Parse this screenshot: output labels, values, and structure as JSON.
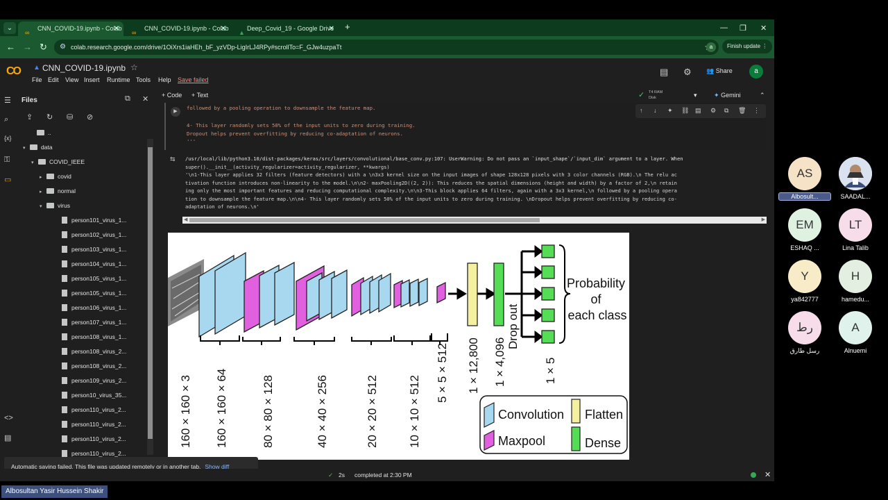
{
  "browser": {
    "tabs": [
      {
        "title": "CNN_COVID-19.ipynb - Colab",
        "active": true
      },
      {
        "title": "CNN_COVID-19.ipynb - Colab",
        "active": false
      },
      {
        "title": "Deep_Covid_19 - Google Drive",
        "active": false
      }
    ],
    "new_tab": "+",
    "url": "colab.research.google.com/drive/1OiXrs1iaHEh_bF_yzVDp-LigIrLJ4RPy#scrollTo=F_GJw4uzpaTt",
    "profile_initial": "a",
    "finish_update": "Finish update"
  },
  "colab": {
    "notebook_title": "CNN_COVID-19.ipynb",
    "menu": [
      "File",
      "Edit",
      "View",
      "Insert",
      "Runtime",
      "Tools",
      "Help"
    ],
    "save_status": "Save failed",
    "share": "Share",
    "user_initial": "a",
    "add_code": "+ Code",
    "add_text": "+ Text",
    "runtime_label": "T4",
    "ram_label": "RAM",
    "disk_label": "Disk",
    "gemini": "Gemini"
  },
  "files_panel": {
    "title": "Files",
    "tree": [
      {
        "label": "..",
        "kind": "folder",
        "arrow": ""
      },
      {
        "label": "data",
        "kind": "folder",
        "arrow": "▾"
      },
      {
        "label": "COVID_IEEE",
        "kind": "folder",
        "arrow": "▾"
      },
      {
        "label": "covid",
        "kind": "folder",
        "arrow": "▸"
      },
      {
        "label": "normal",
        "kind": "folder",
        "arrow": "▸"
      },
      {
        "label": "virus",
        "kind": "folder",
        "arrow": "▾"
      },
      {
        "label": "person101_virus_1...",
        "kind": "file"
      },
      {
        "label": "person102_virus_1...",
        "kind": "file"
      },
      {
        "label": "person103_virus_1...",
        "kind": "file"
      },
      {
        "label": "person104_virus_1...",
        "kind": "file"
      },
      {
        "label": "person105_virus_1...",
        "kind": "file"
      },
      {
        "label": "person105_virus_1...",
        "kind": "file"
      },
      {
        "label": "person106_virus_1...",
        "kind": "file"
      },
      {
        "label": "person107_virus_1...",
        "kind": "file"
      },
      {
        "label": "person108_virus_1...",
        "kind": "file"
      },
      {
        "label": "person108_virus_2...",
        "kind": "file"
      },
      {
        "label": "person108_virus_2...",
        "kind": "file"
      },
      {
        "label": "person109_virus_2...",
        "kind": "file"
      },
      {
        "label": "person10_virus_35...",
        "kind": "file"
      },
      {
        "label": "person110_virus_2...",
        "kind": "file"
      },
      {
        "label": "person110_virus_2...",
        "kind": "file"
      },
      {
        "label": "person110_virus_2...",
        "kind": "file"
      },
      {
        "label": "person110_virus_2...",
        "kind": "file"
      }
    ]
  },
  "toast": {
    "message": "Automatic saving failed. This file was updated remotely or in another tab.",
    "action": "Show diff"
  },
  "cell": {
    "lines": [
      "followed by a pooling operation to downsample the feature map.",
      "",
      "4- This layer randomly sets 50% of the input units to zero during training.",
      "Dropout helps prevent overfitting by reducing co-adaptation of neurons.",
      "'''"
    ]
  },
  "output": {
    "lines": [
      "/usr/local/lib/python3.10/dist-packages/keras/src/layers/convolutional/base_conv.py:107: UserWarning: Do not pass an `input_shape`/`input_dim` argument to a layer. When",
      "  super().__init__(activity_regularizer=activity_regularizer, **kwargs)",
      "'\\n1-This layer applies 32 filters (feature detectors) with a \\n3x3 kernel size on the input images of shape 128x128 pixels with 3 color channels (RGB).\\n The relu ac",
      "tivation function introduces non-linearity to the model.\\n\\n2- maxPooling2D((2, 2)): This reduces the spatial dimensions (height and width) by a factor of 2,\\n retain",
      "ing only the most important features and reducing computational complexity.\\n\\n3-This block applies 64 filters, again with a 3x3 kernel,\\n followed by a pooling opera",
      "tion to downsample the feature map.\\n\\n4- This layer randomly sets 50% of the input units to zero during training. \\nDropout helps prevent overfitting by reducing co-",
      "adaptation of neurons.\\n'"
    ]
  },
  "figure": {
    "dims": [
      "160 × 160 × 3",
      "160 × 160 × 64",
      "80 × 80 × 128",
      "40 × 40 × 256",
      "20 × 20 × 512",
      "10 × 10 × 512",
      "5 × 5 × 512",
      "1 × 12,800",
      "1 × 4,096",
      "1 × 5"
    ],
    "dropout": "Drop out",
    "output_text": [
      "Probability",
      "of",
      "each class"
    ],
    "legend": [
      "Convolution",
      "Flatten",
      "Maxpool",
      "Dense"
    ],
    "colors": {
      "convolution": "#a8d8f0",
      "maxpool": "#e060e0",
      "flatten": "#f5f0a0",
      "dense": "#55dd55"
    }
  },
  "status": {
    "elapsed": "2s",
    "completed": "completed at 2:30 PM"
  },
  "participants": [
    {
      "initials": "AS",
      "name": "Albosult...",
      "bg": "#f6e3c7",
      "selected": true
    },
    {
      "initials": "",
      "name": "SAADAL...",
      "bg": "#d9e2ee",
      "photo": true
    },
    {
      "initials": "EM",
      "name": "ESHAQ ...",
      "bg": "#dff2e1"
    },
    {
      "initials": "LT",
      "name": "Lina Talib",
      "bg": "#f7dcea"
    },
    {
      "initials": "Y",
      "name": "ya842777",
      "bg": "#f8ecc8"
    },
    {
      "initials": "H",
      "name": "hamedu...",
      "bg": "#e3efe0"
    },
    {
      "initials": "رط",
      "name": "رسل طارق",
      "bg": "#f7dcea"
    },
    {
      "initials": "A",
      "name": "Alnuemi",
      "bg": "#dff2ec"
    }
  ],
  "speaker_name": "Albosultan Yasir Hussein Shakir"
}
